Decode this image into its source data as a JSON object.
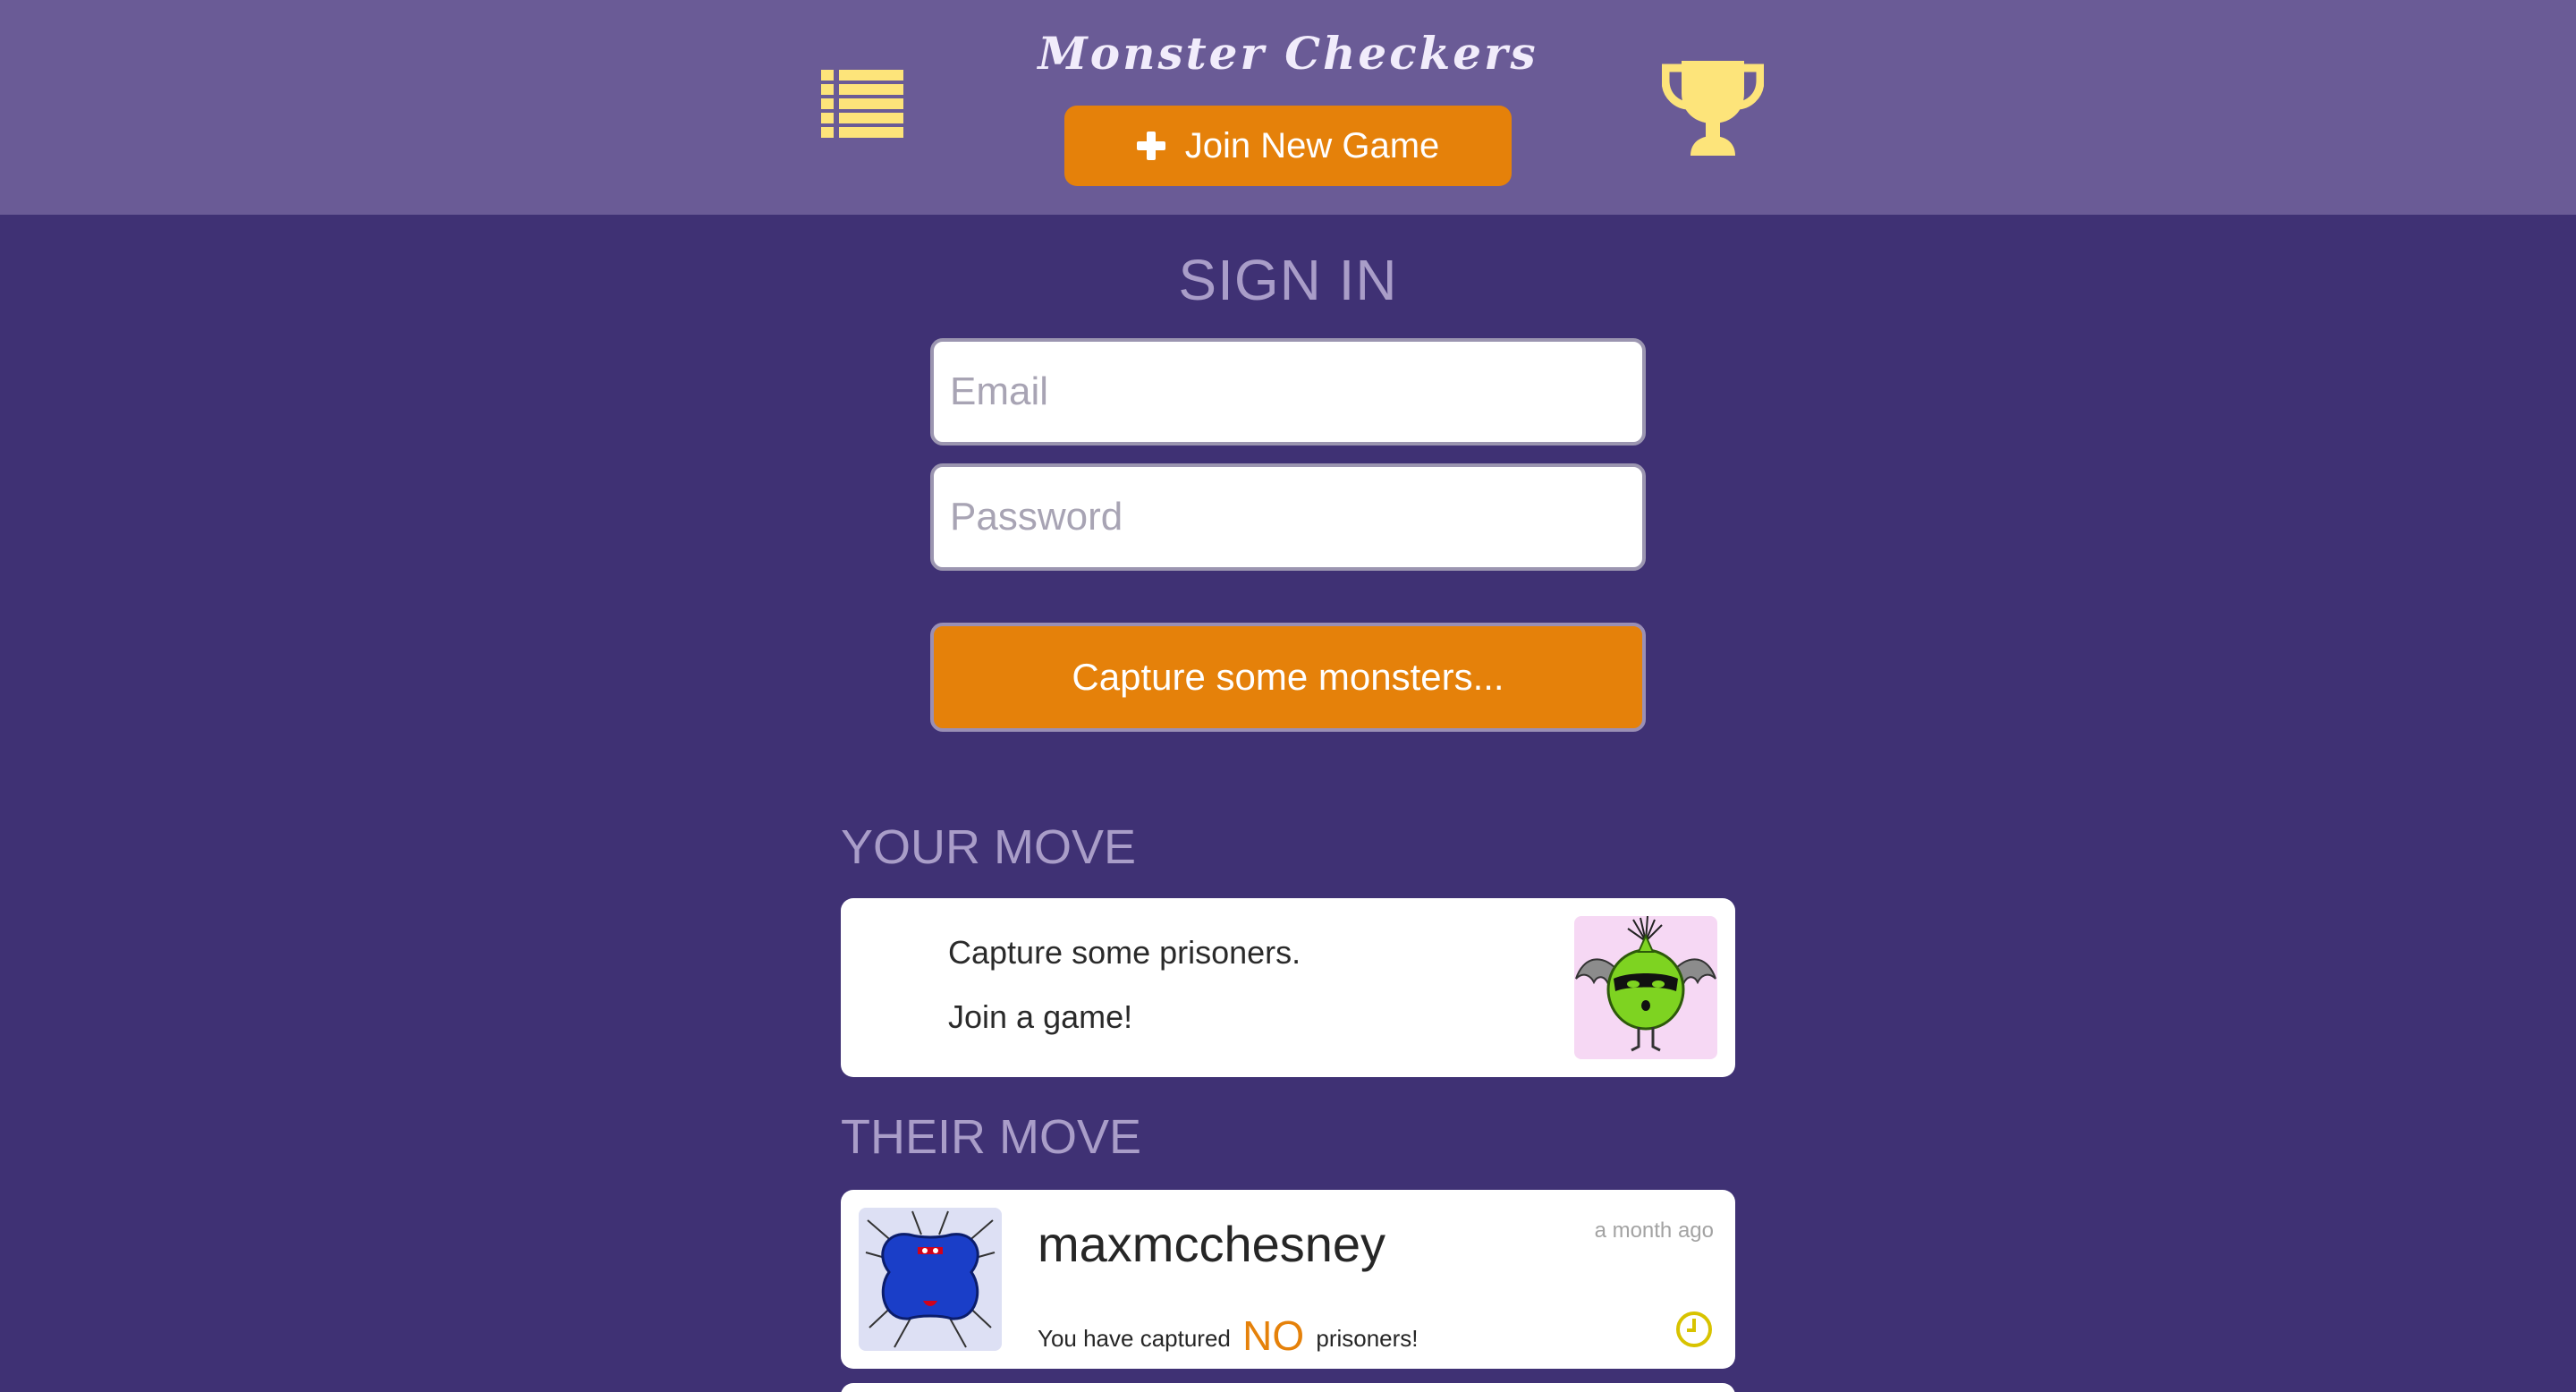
{
  "header": {
    "title": "Monster Checkers",
    "join_button_label": "Join New Game",
    "menu_icon": "list-icon",
    "trophy_icon": "trophy-icon",
    "accent_color": "#e5810a",
    "icon_color": "#fde47a"
  },
  "signin": {
    "title": "SIGN IN",
    "email_placeholder": "Email",
    "email_value": "",
    "password_placeholder": "Password",
    "password_value": "",
    "submit_label": "Capture some monsters..."
  },
  "your_move": {
    "title": "YOUR MOVE",
    "line1": "Capture some prisoners.",
    "line2": "Join a game!"
  },
  "their_move": {
    "title": "THEIR MOVE",
    "games": [
      {
        "opponent": "maxmcchesney",
        "time_ago": "a month ago",
        "status_prefix": "You have captured",
        "captured_count": "NO",
        "status_suffix": "prisoners!"
      }
    ]
  },
  "colors": {
    "page_background": "#3f3174",
    "header_background": "#6a5b96",
    "section_title": "#a99dc8"
  }
}
